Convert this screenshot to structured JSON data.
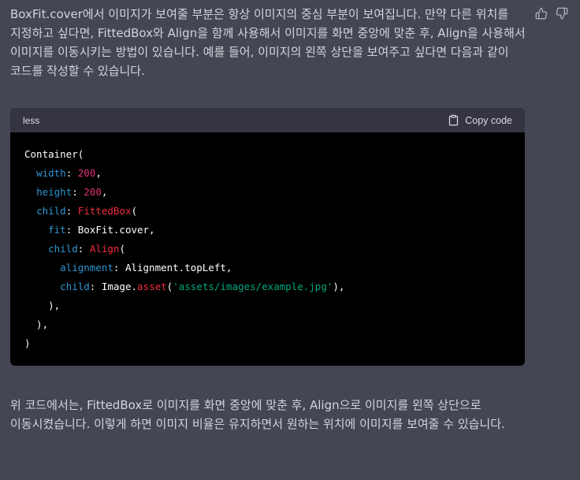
{
  "intro_text": "BoxFit.cover에서 이미지가 보여줄 부분은 항상 이미지의 중심 부분이 보여집니다. 만약 다른 위치를 지정하고 싶다면, FittedBox와 Align을 함께 사용해서 이미지를 화면 중앙에 맞춘 후, Align을 사용해서 이미지를 이동시키는 방법이 있습니다. 예를 들어, 이미지의 왼쪽 상단을 보여주고 싶다면 다음과 같이 코드를 작성할 수 있습니다.",
  "code_block": {
    "language": "less",
    "copy_label": "Copy code",
    "lines": [
      [
        {
          "t": "Container(",
          "c": "plain"
        }
      ],
      [
        {
          "t": "  ",
          "c": "plain"
        },
        {
          "t": "width",
          "c": "prop"
        },
        {
          "t": ": ",
          "c": "plain"
        },
        {
          "t": "200",
          "c": "num"
        },
        {
          "t": ",",
          "c": "plain"
        }
      ],
      [
        {
          "t": "  ",
          "c": "plain"
        },
        {
          "t": "height",
          "c": "prop"
        },
        {
          "t": ": ",
          "c": "plain"
        },
        {
          "t": "200",
          "c": "num"
        },
        {
          "t": ",",
          "c": "plain"
        }
      ],
      [
        {
          "t": "  ",
          "c": "plain"
        },
        {
          "t": "child",
          "c": "prop"
        },
        {
          "t": ": ",
          "c": "plain"
        },
        {
          "t": "FittedBox",
          "c": "fn"
        },
        {
          "t": "(",
          "c": "plain"
        }
      ],
      [
        {
          "t": "    ",
          "c": "plain"
        },
        {
          "t": "fit",
          "c": "prop"
        },
        {
          "t": ": BoxFit.cover,",
          "c": "plain"
        }
      ],
      [
        {
          "t": "    ",
          "c": "plain"
        },
        {
          "t": "child",
          "c": "prop"
        },
        {
          "t": ": ",
          "c": "plain"
        },
        {
          "t": "Align",
          "c": "fn"
        },
        {
          "t": "(",
          "c": "plain"
        }
      ],
      [
        {
          "t": "      ",
          "c": "plain"
        },
        {
          "t": "alignment",
          "c": "prop"
        },
        {
          "t": ": Alignment.topLeft,",
          "c": "plain"
        }
      ],
      [
        {
          "t": "      ",
          "c": "plain"
        },
        {
          "t": "child",
          "c": "prop"
        },
        {
          "t": ": Image.",
          "c": "plain"
        },
        {
          "t": "asset",
          "c": "fn"
        },
        {
          "t": "(",
          "c": "plain"
        },
        {
          "t": "'assets/images/example.jpg'",
          "c": "str"
        },
        {
          "t": "),",
          "c": "plain"
        }
      ],
      [
        {
          "t": "    ),",
          "c": "plain"
        }
      ],
      [
        {
          "t": "  ),",
          "c": "plain"
        }
      ],
      [
        {
          "t": ")",
          "c": "plain"
        }
      ]
    ]
  },
  "outro_text": "위 코드에서는, FittedBox로 이미지를 화면 중앙에 맞춘 후, Align으로 이미지를 왼쪽 상단으로 이동시켰습니다. 이렇게 하면 이미지 비율은 유지하면서 원하는 위치에 이미지를 보여줄 수 있습니다.",
  "icons": {
    "thumbs_up": "thumbs-up-icon",
    "thumbs_down": "thumbs-down-icon",
    "clipboard": "clipboard-icon"
  },
  "colors": {
    "background": "#444654",
    "text": "#d1d5db",
    "code_bg": "#000000",
    "code_header_bg": "#343541",
    "token_property": "#2e95d3",
    "token_number": "#df3079",
    "token_function": "#f22c3d",
    "token_string": "#00a67d"
  }
}
